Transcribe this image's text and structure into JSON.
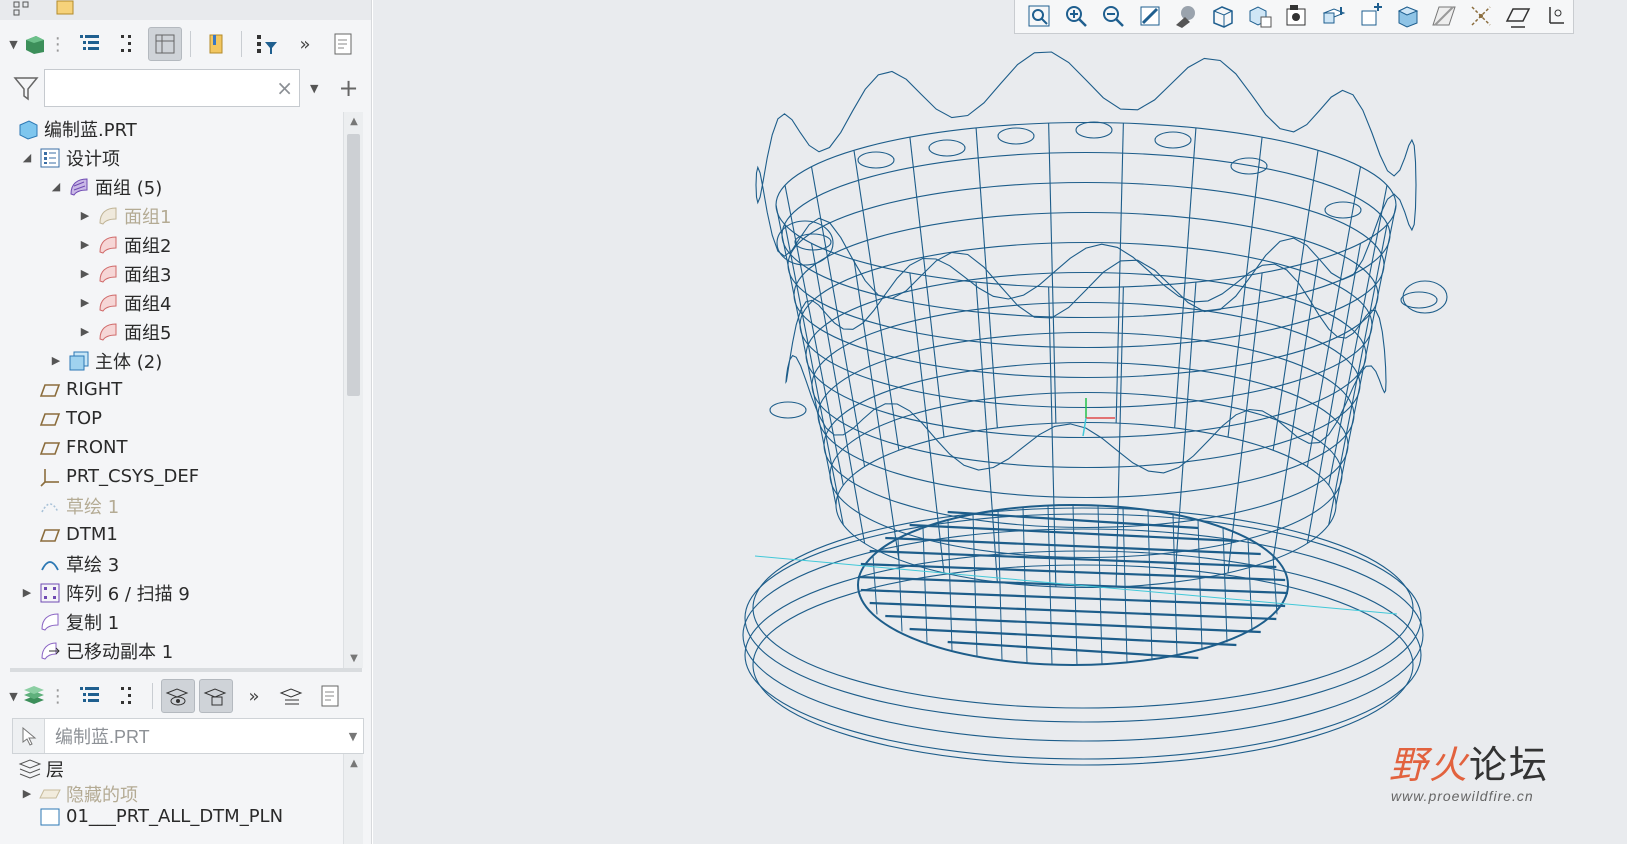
{
  "model_tree": {
    "search": {
      "value": "",
      "placeholder": "",
      "clear": "×"
    },
    "toolbar": {
      "more": "»"
    },
    "items": [
      {
        "label": "编制蓝.PRT",
        "icon": "part-icon"
      },
      {
        "label": "设计项",
        "icon": "design-items-icon"
      },
      {
        "label": "面组 (5)",
        "icon": "quilt-group-icon"
      },
      {
        "label": "面组1",
        "icon": "quilt-icon-dim"
      },
      {
        "label": "面组2",
        "icon": "quilt-icon"
      },
      {
        "label": "面组3",
        "icon": "quilt-icon"
      },
      {
        "label": "面组4",
        "icon": "quilt-icon"
      },
      {
        "label": "面组5",
        "icon": "quilt-icon"
      },
      {
        "label": "主体 (2)",
        "icon": "body-icon"
      },
      {
        "label": "RIGHT",
        "icon": "datum-plane-icon"
      },
      {
        "label": "TOP",
        "icon": "datum-plane-icon"
      },
      {
        "label": "FRONT",
        "icon": "datum-plane-icon"
      },
      {
        "label": "PRT_CSYS_DEF",
        "icon": "csys-icon"
      },
      {
        "label": "草绘 1",
        "icon": "sketch-icon-dim"
      },
      {
        "label": "DTM1",
        "icon": "datum-plane-icon"
      },
      {
        "label": "草绘 3",
        "icon": "sketch-icon"
      },
      {
        "label": "阵列 6 / 扫描 9",
        "icon": "pattern-icon"
      },
      {
        "label": "复制 1",
        "icon": "copy-icon"
      },
      {
        "label": "已移动副本 1",
        "icon": "moved-copy-icon"
      }
    ]
  },
  "layer_tree": {
    "toolbar": {
      "more": "»"
    },
    "active_model": "编制蓝.PRT",
    "items": [
      {
        "label": "层",
        "icon": "layers-icon"
      },
      {
        "label": "隐藏的项",
        "icon": "hidden-items-icon"
      },
      {
        "label": "01___PRT_ALL_DTM_PLN",
        "icon": "layer-icon"
      }
    ]
  },
  "graphics_toolbar": {
    "buttons": [
      "refit-icon",
      "zoom-in-icon",
      "zoom-out-icon",
      "repaint-icon",
      "display-style-icon",
      "saved-orientations-icon",
      "view-manager-icon",
      "perspective-view-icon",
      "section-icon",
      "spin-center-icon",
      "datum-display-icon",
      "annotation-display-icon",
      "plane-display-icon",
      "point-display-icon",
      "csys-display-icon"
    ]
  },
  "watermark": {
    "logo_a": "野火",
    "logo_b": "论坛",
    "url": "www.proewildfire.cn"
  },
  "colors": {
    "wire": "#1d5d8a",
    "axis_green": "#22c24a",
    "axis_red": "#e04a4a",
    "axis_cyan": "#41c8d8",
    "viewport_bg": "#e9ebee"
  }
}
